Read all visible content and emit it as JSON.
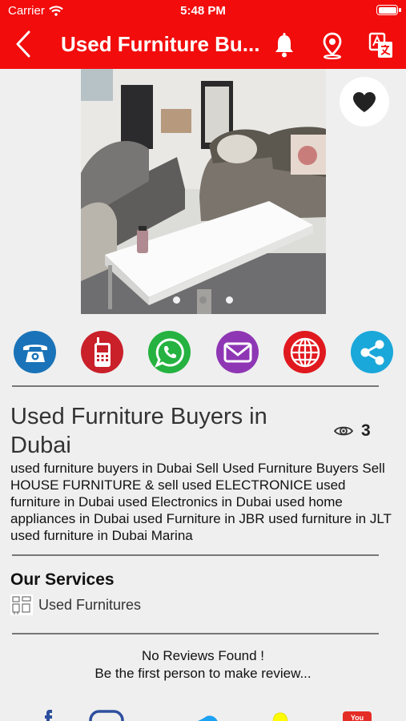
{
  "status_bar": {
    "carrier": "Carrier",
    "time": "5:48 PM"
  },
  "nav": {
    "title": "Used Furniture Bu..."
  },
  "icons": {
    "back": "chevron-left-icon",
    "bell": "bell-icon",
    "location": "map-pin-icon",
    "translate": "translate-icon",
    "favorite": "heart-icon",
    "views": "eye-icon"
  },
  "gallery": {
    "pages": 3,
    "current_page": 2
  },
  "contacts": [
    {
      "name": "phone-icon",
      "color": "#1a73b8"
    },
    {
      "name": "mobile-icon",
      "color": "#c9202a"
    },
    {
      "name": "whatsapp-icon",
      "color": "#25b240"
    },
    {
      "name": "email-icon",
      "color": "#8e36b4"
    },
    {
      "name": "website-icon",
      "color": "#e0191f"
    },
    {
      "name": "share-icon",
      "color": "#1aa7d9"
    }
  ],
  "listing": {
    "title": "Used Furniture Buyers in Dubai",
    "views": "3",
    "description": "used furniture buyers in Dubai Sell Used Furniture Buyers Sell HOUSE FURNITURE & sell used ELECTRONICE used furniture in Dubai used Electronics in Dubai used home appliances in Dubai used Furniture in JBR used furniture in JLT used furniture in Dubai Marina"
  },
  "services": {
    "heading": "Our Services",
    "items": [
      {
        "label": "Used Furnitures"
      }
    ]
  },
  "reviews": {
    "empty_line1": "No Reviews Found !",
    "empty_line2": "Be the first person to make review..."
  },
  "social": [
    "facebook-icon",
    "instagram-icon",
    "twitter-icon",
    "snapchat-icon",
    "youtube-icon"
  ],
  "colors": {
    "brand_red": "#f20c0c",
    "background": "#efefef"
  }
}
